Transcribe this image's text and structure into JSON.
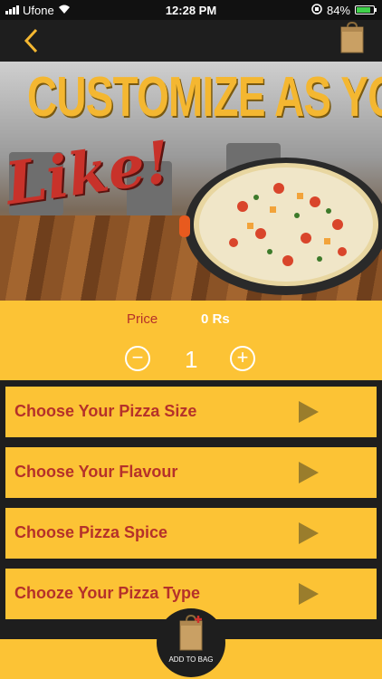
{
  "status_bar": {
    "carrier": "Ufone",
    "time": "12:28 PM",
    "battery": "84%",
    "battery_level": 0.84
  },
  "navbar": {
    "back_icon": "chevron-left-icon",
    "bag_icon": "paper-bag-icon"
  },
  "banner": {
    "headline": "CUSTOMIZE AS YOU",
    "script": "Like!"
  },
  "price": {
    "label": "Price",
    "value": "0 Rs"
  },
  "quantity": {
    "decrement": "−",
    "value": "1",
    "increment": "+"
  },
  "options": [
    {
      "label": "Choose Your Pizza Size"
    },
    {
      "label": "Choose Your Flavour"
    },
    {
      "label": "Choose Pizza Spice"
    },
    {
      "label": "Chooze Your Pizza Type"
    }
  ],
  "add_to_bag": {
    "label": "ADD TO BAG"
  },
  "colors": {
    "accent": "#fcc335",
    "label_red": "#b5312a",
    "dark": "#1e1e1e"
  }
}
